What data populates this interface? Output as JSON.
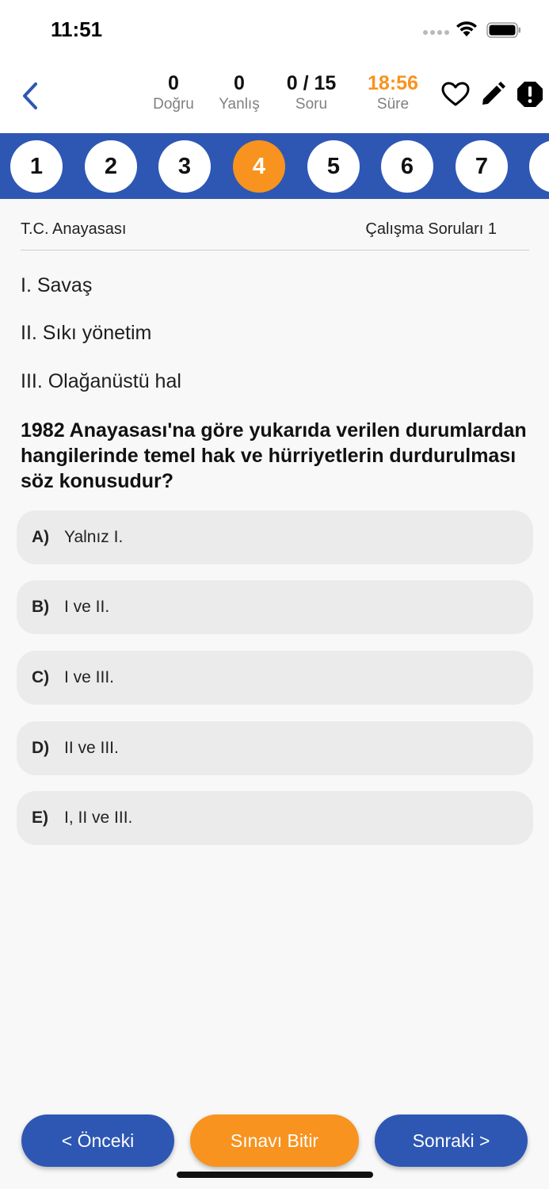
{
  "status_bar": {
    "time": "11:51"
  },
  "header": {
    "stats": {
      "correct": {
        "value": "0",
        "label": "Doğru"
      },
      "wrong": {
        "value": "0",
        "label": "Yanlış"
      },
      "question": {
        "value": "0 / 15",
        "label": "Soru"
      },
      "timer": {
        "value": "18:56",
        "label": "Süre"
      }
    },
    "icons": [
      "back-chevron-icon",
      "heart-icon",
      "pencil-icon",
      "alert-octagon-icon"
    ]
  },
  "question_nav": {
    "items": [
      "1",
      "2",
      "3",
      "4",
      "5",
      "6",
      "7"
    ],
    "active": "4"
  },
  "meta": {
    "subject": "T.C. Anayasası",
    "set": "Çalışma Soruları 1"
  },
  "premises": [
    "I.  Savaş",
    "II.  Sıkı yönetim",
    "III. Olağanüstü hal"
  ],
  "question": "1982 Anayasası'na göre yukarıda verilen durumlardan hangilerinde temel hak ve hürriyetlerin durdurulması söz konusudur?",
  "options": [
    {
      "letter": "A)",
      "text": "Yalnız I."
    },
    {
      "letter": "B)",
      "text": "I ve II."
    },
    {
      "letter": "C)",
      "text": "I ve III."
    },
    {
      "letter": "D)",
      "text": "II ve III."
    },
    {
      "letter": "E)",
      "text": "I, II ve III."
    }
  ],
  "buttons": {
    "prev": "< Önceki",
    "finish": "Sınavı Bitir",
    "next": "Sonraki >"
  },
  "colors": {
    "primary": "#2e57b4",
    "accent": "#f7931e",
    "option_bg": "#ebebeb",
    "background": "#f8f8f8"
  }
}
